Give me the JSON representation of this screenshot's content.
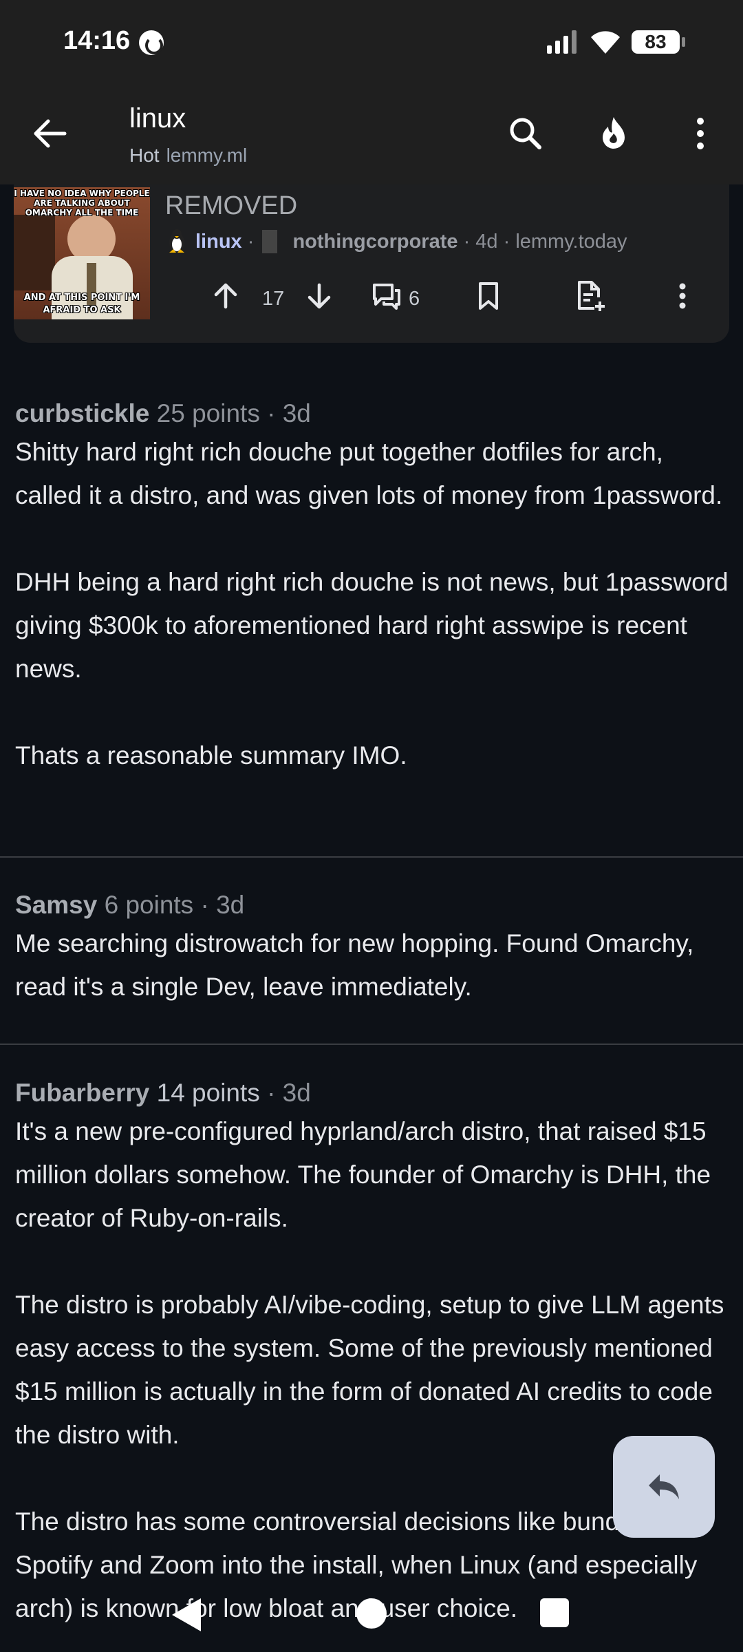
{
  "status_bar": {
    "time": "14:16",
    "battery": "83"
  },
  "app_bar": {
    "title": "linux",
    "sort": "Hot",
    "instance": "lemmy.ml"
  },
  "post": {
    "thumbnail": {
      "top_text": "I HAVE NO IDEA WHY PEOPLE ARE TALKING ABOUT OMARCHY ALL THE TIME",
      "bottom_text": "AND AT THIS POINT I'M AFRAID TO ASK"
    },
    "title": "REMOVED",
    "community": "linux",
    "separator1": "·",
    "author": "nothingcorporate",
    "age": "· 4d · lemmy.today",
    "score": "17",
    "comments": "6"
  },
  "comments": [
    {
      "author": "curbstickle",
      "points": "25 points",
      "age": "· 3d",
      "paragraphs": [
        "Shitty hard right rich douche put together dotfiles for arch, called it a distro, and was given lots of money from 1password.",
        "DHH being a hard right rich douche is not news, but 1password giving $300k to aforementioned hard right asswipe is recent news.",
        "Thats a reasonable summary IMO."
      ]
    },
    {
      "author": "Samsy",
      "points": "6 points",
      "age": "· 3d",
      "paragraphs": [
        "Me searching distrowatch for new hopping. Found Omarchy, read it's a single Dev, leave immediately."
      ]
    },
    {
      "author": "Fubarberry",
      "points": "14 points",
      "age": "· 3d",
      "paragraphs": [
        "It's a new pre-configured hyprland/arch distro, that raised $15 million dollars somehow. The founder of Omarchy is DHH, the creator of Ruby-on-rails.",
        "The distro is probably AI/vibe-coding, setup to give LLM agents easy access to the system. Some of the previously mentioned $15 million is actually in the form of donated AI credits to code the distro with.",
        "The distro has some controversial decisions like bundling Spotify and Zoom into the install, when Linux (and especially arch) is known for low bloat and user choice."
      ]
    }
  ],
  "icons": {
    "back": "arrow-left-icon",
    "search": "search-icon",
    "sort": "flame-icon",
    "more": "more-vertical-icon",
    "upvote": "arrow-up-icon",
    "downvote": "arrow-down-icon",
    "comments": "comments-icon",
    "bookmark": "bookmark-icon",
    "file": "file-add-icon",
    "reply": "reply-icon"
  },
  "colors": {
    "background": "#0d1117",
    "bar": "#1f1f1f",
    "card": "#1e1f21",
    "community": "#b9c4f5",
    "fab": "#cfd6e5"
  }
}
